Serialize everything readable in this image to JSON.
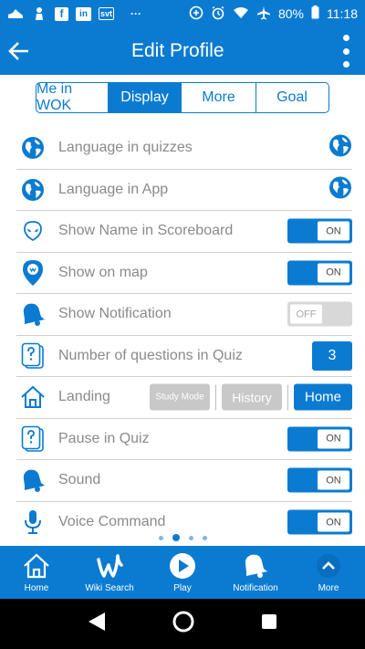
{
  "status_bar": {
    "left_icons": [
      "shoe-icon",
      "king-piece-icon",
      "facebook-icon",
      "linkedin-icon",
      "svt-icon",
      "more-dots-icon"
    ],
    "svt_label": "svt",
    "fb_label": "f",
    "li_label": "in",
    "dots_label": "···",
    "battery": "80%",
    "time": "11:18"
  },
  "appbar": {
    "title": "Edit Profile"
  },
  "tabs": [
    {
      "label": "Me in WOK",
      "active": false
    },
    {
      "label": "Display",
      "active": true
    },
    {
      "label": "More",
      "active": false
    },
    {
      "label": "Goal",
      "active": false
    }
  ],
  "settings": {
    "language_quizzes": {
      "label": "Language in quizzes"
    },
    "language_app": {
      "label": "Language in App"
    },
    "show_name": {
      "label": "Show Name in Scoreboard",
      "state": "ON"
    },
    "show_map": {
      "label": "Show on map",
      "state": "ON"
    },
    "show_notification": {
      "label": "Show Notification",
      "state": "OFF"
    },
    "num_questions": {
      "label": "Number of questions in Quiz",
      "value": "3"
    },
    "landing": {
      "label": "Landing",
      "options": [
        "Study Mode",
        "History",
        "Home"
      ],
      "selected": "Home"
    },
    "pause_quiz": {
      "label": "Pause in Quiz",
      "state": "ON"
    },
    "sound": {
      "label": "Sound",
      "state": "ON"
    },
    "voice_command": {
      "label": "Voice Command",
      "state": "ON"
    }
  },
  "page_dots": {
    "count": 4,
    "active_index": 1
  },
  "bottom_nav": [
    {
      "label": "Home",
      "icon": "home-icon"
    },
    {
      "label": "Wiki Search",
      "icon": "wiki-w-icon"
    },
    {
      "label": "Play",
      "icon": "play-icon"
    },
    {
      "label": "Notification",
      "icon": "bell-icon"
    },
    {
      "label": "More",
      "icon": "chevron-up-icon"
    }
  ],
  "colors": {
    "primary": "#0b7bd1",
    "toggle_off": "#d8d8d8",
    "inactive_button": "#c8c8c8"
  }
}
